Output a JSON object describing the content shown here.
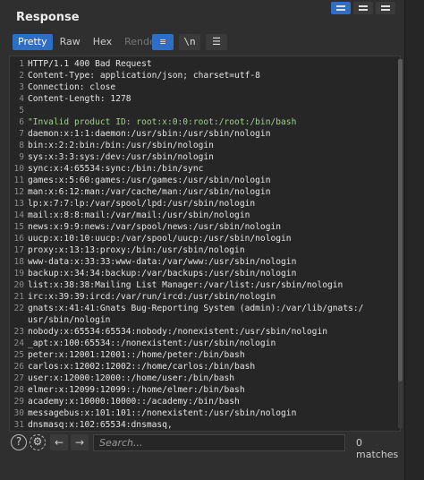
{
  "panel": {
    "title": "Response"
  },
  "tabs": [
    {
      "label": "Pretty",
      "state": "active"
    },
    {
      "label": "Raw",
      "state": "normal"
    },
    {
      "label": "Hex",
      "state": "normal"
    },
    {
      "label": "Render",
      "state": "disabled"
    }
  ],
  "toolbar": {
    "wrap_icon": "wrap-lines-icon",
    "newline_label": "\\n",
    "menu_icon": "hamburger-menu-icon"
  },
  "lines": [
    {
      "n": "1",
      "t": "HTTP/1.1 400 Bad Request"
    },
    {
      "n": "2",
      "t": "Content-Type: application/json; charset=utf-8"
    },
    {
      "n": "3",
      "t": "Connection: close"
    },
    {
      "n": "4",
      "t": "Content-Length: 1278"
    },
    {
      "n": "5",
      "t": ""
    },
    {
      "n": "6",
      "t": "\"Invalid product ID: root:x:0:0:root:/root:/bin/bash",
      "str": true
    },
    {
      "n": "7",
      "t": "daemon:x:1:1:daemon:/usr/sbin:/usr/sbin/nologin"
    },
    {
      "n": "8",
      "t": "bin:x:2:2:bin:/bin:/usr/sbin/nologin"
    },
    {
      "n": "9",
      "t": "sys:x:3:3:sys:/dev:/usr/sbin/nologin"
    },
    {
      "n": "10",
      "t": "sync:x:4:65534:sync:/bin:/bin/sync"
    },
    {
      "n": "11",
      "t": "games:x:5:60:games:/usr/games:/usr/sbin/nologin"
    },
    {
      "n": "12",
      "t": "man:x:6:12:man:/var/cache/man:/usr/sbin/nologin"
    },
    {
      "n": "13",
      "t": "lp:x:7:7:lp:/var/spool/lpd:/usr/sbin/nologin"
    },
    {
      "n": "14",
      "t": "mail:x:8:8:mail:/var/mail:/usr/sbin/nologin"
    },
    {
      "n": "15",
      "t": "news:x:9:9:news:/var/spool/news:/usr/sbin/nologin"
    },
    {
      "n": "16",
      "t": "uucp:x:10:10:uucp:/var/spool/uucp:/usr/sbin/nologin"
    },
    {
      "n": "17",
      "t": "proxy:x:13:13:proxy:/bin:/usr/sbin/nologin"
    },
    {
      "n": "18",
      "t": "www-data:x:33:33:www-data:/var/www:/usr/sbin/nologin"
    },
    {
      "n": "19",
      "t": "backup:x:34:34:backup:/var/backups:/usr/sbin/nologin"
    },
    {
      "n": "20",
      "t": "list:x:38:38:Mailing List Manager:/var/list:/usr/sbin/nologin"
    },
    {
      "n": "21",
      "t": "irc:x:39:39:ircd:/var/run/ircd:/usr/sbin/nologin"
    },
    {
      "n": "22",
      "t": "gnats:x:41:41:Gnats Bug-Reporting System (admin):/var/lib/gnats:/"
    },
    {
      "n": "",
      "t": "usr/sbin/nologin"
    },
    {
      "n": "23",
      "t": "nobody:x:65534:65534:nobody:/nonexistent:/usr/sbin/nologin"
    },
    {
      "n": "24",
      "t": "_apt:x:100:65534::/nonexistent:/usr/sbin/nologin"
    },
    {
      "n": "25",
      "t": "peter:x:12001:12001::/home/peter:/bin/bash"
    },
    {
      "n": "26",
      "t": "carlos:x:12002:12002::/home/carlos:/bin/bash"
    },
    {
      "n": "27",
      "t": "user:x:12000:12000::/home/user:/bin/bash"
    },
    {
      "n": "28",
      "t": "elmer:x:12099:12099::/home/elmer:/bin/bash"
    },
    {
      "n": "29",
      "t": "academy:x:10000:10000::/academy:/bin/bash"
    },
    {
      "n": "30",
      "t": "messagebus:x:101:101::/nonexistent:/usr/sbin/nologin"
    },
    {
      "n": "31",
      "t": "dnsmasq:x:102:65534:dnsmasq,"
    }
  ],
  "footer": {
    "help_icon": "help-icon",
    "settings_icon": "gear-icon",
    "prev_icon": "arrow-left-icon",
    "next_icon": "arrow-right-icon",
    "search_placeholder": "Search...",
    "matches": "0 matches"
  },
  "colors": {
    "accent": "#2e6fc5",
    "string": "#9fd08a"
  }
}
